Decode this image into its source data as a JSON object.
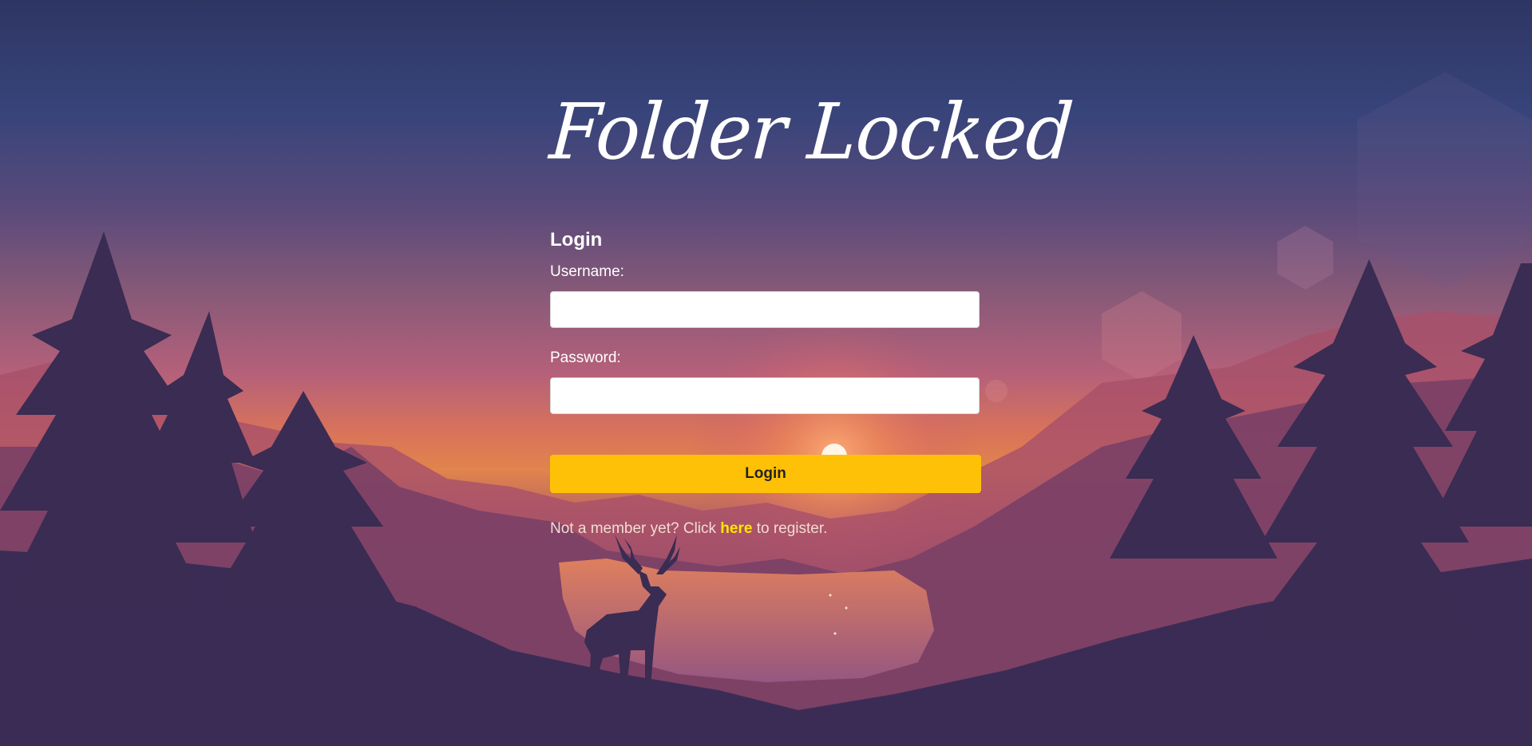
{
  "page": {
    "title": "Folder Locked"
  },
  "form": {
    "heading": "Login",
    "username_label": "Username:",
    "username_value": "",
    "password_label": "Password:",
    "password_value": "",
    "submit_label": "Login"
  },
  "register": {
    "prefix": "Not a member yet? Click ",
    "link_label": "here",
    "suffix": " to register."
  },
  "colors": {
    "accent": "#ffc107",
    "link": "#ffe600",
    "sky_top": "#2e3563",
    "sunset": "#e1844d",
    "silhouette": "#3a2c52"
  },
  "icons": {
    "background": "sunset-forest-deer-illustration"
  }
}
